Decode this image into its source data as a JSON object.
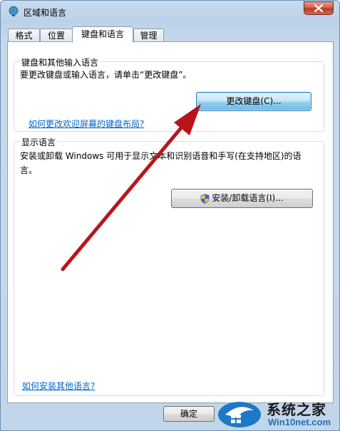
{
  "window": {
    "title": "区域和语言"
  },
  "tabs": [
    {
      "label": "格式"
    },
    {
      "label": "位置"
    },
    {
      "label": "键盘和语言",
      "active": true
    },
    {
      "label": "管理"
    }
  ],
  "keyboard_group": {
    "title": "键盘和其他输入语言",
    "description": "要更改键盘或输入语言，请单击“更改键盘”。",
    "change_button": "更改键盘(C)...",
    "welcome_link": "如何更改欢迎屏幕的键盘布局?"
  },
  "display_group": {
    "title": "显示语言",
    "description_line1": "安装或卸载 Windows 可用于显示文本和识别语音和手写(在支持地区)的语",
    "description_line2": "言。",
    "install_button": "安装/卸载语言(I)..."
  },
  "footer": {
    "help_link": "如何安装其他语言?",
    "ok_button": "确定"
  },
  "watermark": {
    "brand": "系统之家",
    "url": "Win10net.com"
  },
  "colors": {
    "link": "#0066cc",
    "arrow": "#b8151a",
    "titlebar": "#c4d8ee"
  }
}
